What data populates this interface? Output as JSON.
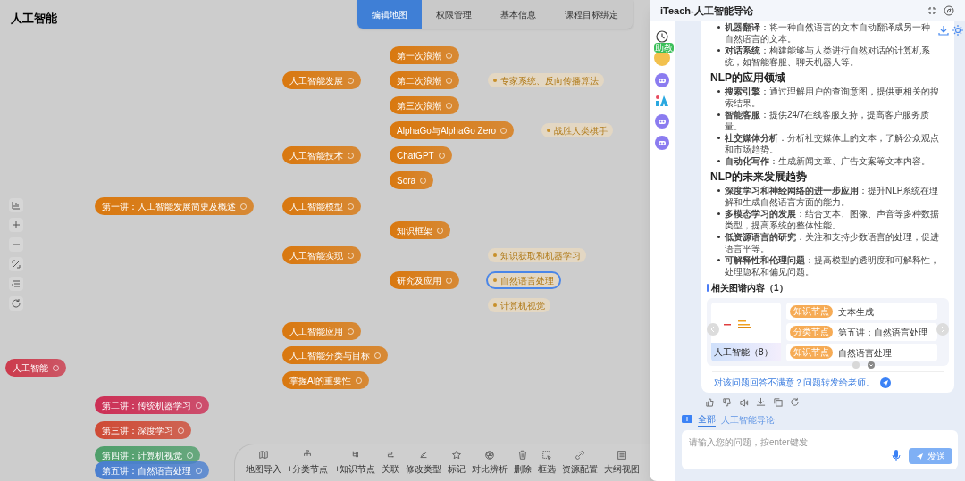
{
  "header": {
    "title": "人工智能"
  },
  "tabs": [
    {
      "label": "编辑地图",
      "selected": true
    },
    {
      "label": "权限管理",
      "selected": false
    },
    {
      "label": "基本信息",
      "selected": false
    },
    {
      "label": "课程目标绑定",
      "selected": false
    }
  ],
  "mindmap": {
    "root": {
      "label": "人工智能",
      "kind": "category",
      "selected": false,
      "color": "#cc3a4c",
      "children": [
        {
          "label": "第一讲：人工智能发展简史及概述",
          "kind": "category",
          "selected": false,
          "color": "#d9780f",
          "children": [
            {
              "label": "人工智能发展",
              "kind": "category",
              "selected": false,
              "children": [
                {
                  "label": "第一次浪潮",
                  "kind": "category",
                  "selected": false
                },
                {
                  "label": "第二次浪潮",
                  "kind": "category",
                  "selected": false,
                  "children": [
                    {
                      "label": "专家系统、反向传播算法",
                      "kind": "knowledge",
                      "selected": false
                    }
                  ]
                },
                {
                  "label": "第三次浪潮",
                  "kind": "category",
                  "selected": false
                }
              ]
            },
            {
              "label": "人工智能技术",
              "kind": "category",
              "selected": false,
              "children": [
                {
                  "label": "AlphaGo与AlphaGo Zero",
                  "kind": "category",
                  "selected": false,
                  "children": [
                    {
                      "label": "战胜人类棋手",
                      "kind": "knowledge",
                      "selected": false
                    }
                  ]
                },
                {
                  "label": "ChatGPT",
                  "kind": "category",
                  "selected": false
                },
                {
                  "label": "Sora",
                  "kind": "category",
                  "selected": false
                }
              ]
            },
            {
              "label": "人工智能模型",
              "kind": "category",
              "selected": false
            },
            {
              "label": "人工智能实现",
              "kind": "category",
              "selected": false,
              "children": [
                {
                  "label": "知识框架",
                  "kind": "category",
                  "selected": false
                },
                {
                  "label": "研究及应用",
                  "kind": "category",
                  "selected": false,
                  "children": [
                    {
                      "label": "知识获取和机器学习",
                      "kind": "knowledge",
                      "selected": false
                    },
                    {
                      "label": "自然语言处理",
                      "kind": "knowledge",
                      "selected": true
                    },
                    {
                      "label": "计算机视觉",
                      "kind": "knowledge",
                      "selected": false
                    }
                  ]
                }
              ]
            },
            {
              "label": "人工智能应用",
              "kind": "category",
              "selected": false
            },
            {
              "label": "人工智能分类与目标",
              "kind": "category",
              "selected": false
            },
            {
              "label": "掌握AI的重要性",
              "kind": "category",
              "selected": false
            }
          ]
        },
        {
          "label": "第二讲：传统机器学习",
          "kind": "category",
          "selected": false,
          "color": "#cc2f55"
        },
        {
          "label": "第三讲：深度学习",
          "kind": "category",
          "selected": false,
          "color": "#cf4a35"
        },
        {
          "label": "第四讲：计算机视觉",
          "kind": "category",
          "selected": false,
          "color": "#4e9e6a"
        },
        {
          "label": "第五讲：自然语言处理",
          "kind": "category",
          "selected": false,
          "color": "#4a7fd0"
        }
      ]
    }
  },
  "toolbar": [
    {
      "label": "地图导入"
    },
    {
      "label": "+分类节点"
    },
    {
      "label": "+知识节点"
    },
    {
      "label": "关联"
    },
    {
      "label": "修改类型"
    },
    {
      "label": "标记"
    },
    {
      "label": "对比辨析"
    },
    {
      "label": "删除"
    },
    {
      "label": "框选"
    },
    {
      "label": "资源配置"
    },
    {
      "label": "大纲视图"
    }
  ],
  "assistant": {
    "title": "iTeach-人工智能导论",
    "avatar_badge": "助教",
    "content": [
      {
        "kind": "list",
        "items": [
          "**机器翻译**：将一种自然语言的文本自动翻译成另一种自然语言的文本。",
          "**对话系统**：构建能够与人类进行自然对话的计算机系统，如智能客服、聊天机器人等。"
        ]
      },
      {
        "kind": "heading",
        "text": "NLP的应用领域"
      },
      {
        "kind": "list",
        "items": [
          "**搜索引擎**：通过理解用户的查询意图，提供更相关的搜索结果。",
          "**智能客服**：提供24/7在线客服支持，提高客户服务质量。",
          "**社交媒体分析**：分析社交媒体上的文本，了解公众观点和市场趋势。",
          "**自动化写作**：生成新闻文章、广告文案等文本内容。"
        ]
      },
      {
        "kind": "heading",
        "text": "NLP的未来发展趋势"
      },
      {
        "kind": "list",
        "items": [
          "**深度学习和神经网络的进一步应用**：提升NLP系统在理解和生成自然语言方面的能力。",
          "**多模态学习的发展**：结合文本、图像、声音等多种数据类型，提高系统的整体性能。",
          "**低资源语言的研究**：关注和支持少数语言的处理，促进语言平等。",
          "**可解释性和伦理问题**：提高模型的透明度和可解释性，处理隐私和偏见问题。"
        ]
      }
    ],
    "related": {
      "title": "相关图谱内容（1）",
      "map_title": "人工智能（8）",
      "nodes": [
        {
          "tag": "知识节点",
          "label": "文本生成"
        },
        {
          "tag": "分类节点",
          "label": "第五讲：自然语言处理"
        },
        {
          "tag": "知识节点",
          "label": "自然语言处理"
        }
      ]
    },
    "feedback_link": "对该问题回答不满意？问题转发给老师。",
    "scope_tabs": [
      {
        "label": "全部",
        "selected": true
      },
      {
        "label": "人工智能导论",
        "selected": false
      }
    ],
    "input": {
      "placeholder": "请输入您的问题，按enter键发"
    },
    "send_button": "发送"
  }
}
